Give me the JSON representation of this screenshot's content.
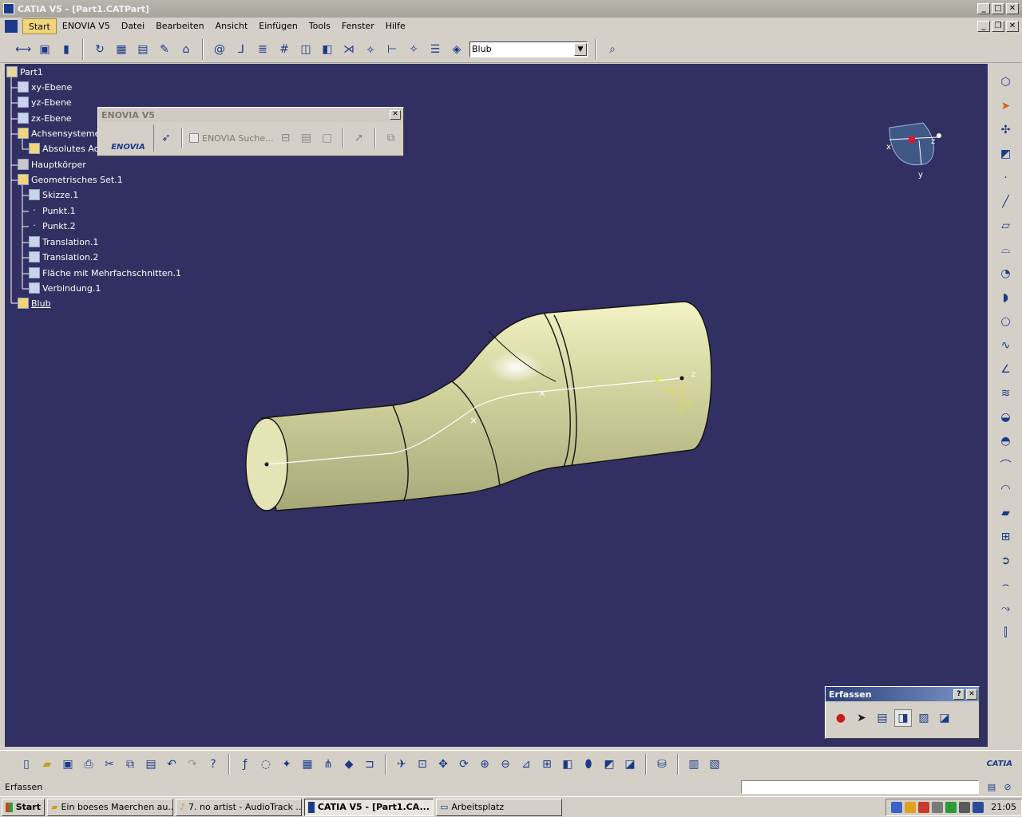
{
  "window": {
    "title": "CATIA V5 - [Part1.CATPart]"
  },
  "menu": [
    "Start",
    "ENOVIA V5",
    "Datei",
    "Bearbeiten",
    "Ansicht",
    "Einfügen",
    "Tools",
    "Fenster",
    "Hilfe"
  ],
  "toolbar": {
    "layer_select": "Blub"
  },
  "tree": {
    "root": "Part1",
    "items": [
      {
        "label": "xy-Ebene"
      },
      {
        "label": "yz-Ebene"
      },
      {
        "label": "zx-Ebene"
      },
      {
        "label": "Achsensysteme"
      },
      {
        "label": "Absolutes Achs"
      },
      {
        "label": "Hauptkörper"
      },
      {
        "label": "Geometrisches Set.1"
      },
      {
        "label": "Skizze.1"
      },
      {
        "label": "Punkt.1"
      },
      {
        "label": "Punkt.2"
      },
      {
        "label": "Translation.1"
      },
      {
        "label": "Translation.2"
      },
      {
        "label": "Fläche mit Mehrfachschnitten.1"
      },
      {
        "label": "Verbindung.1"
      },
      {
        "label": "Blub"
      }
    ]
  },
  "enovia_panel": {
    "title": "ENOVIA V5",
    "logo": "ENOVIA",
    "search_label": "ENOVIA Suche..."
  },
  "erfassen_panel": {
    "title": "Erfassen",
    "help": "?",
    "close": "✕"
  },
  "compass": {
    "x": "x",
    "y": "y",
    "z": "z"
  },
  "model_axis": {
    "z": "z",
    "v": "V"
  },
  "catia_logo": "CATIA",
  "status": {
    "text": "Erfassen"
  },
  "taskbar": {
    "start": "Start",
    "tasks": [
      "Ein boeses Maerchen au...",
      "7. no artist - AudioTrack ...",
      "CATIA V5 - [Part1.CA...",
      "Arbeitsplatz"
    ],
    "clock": "21:05"
  }
}
